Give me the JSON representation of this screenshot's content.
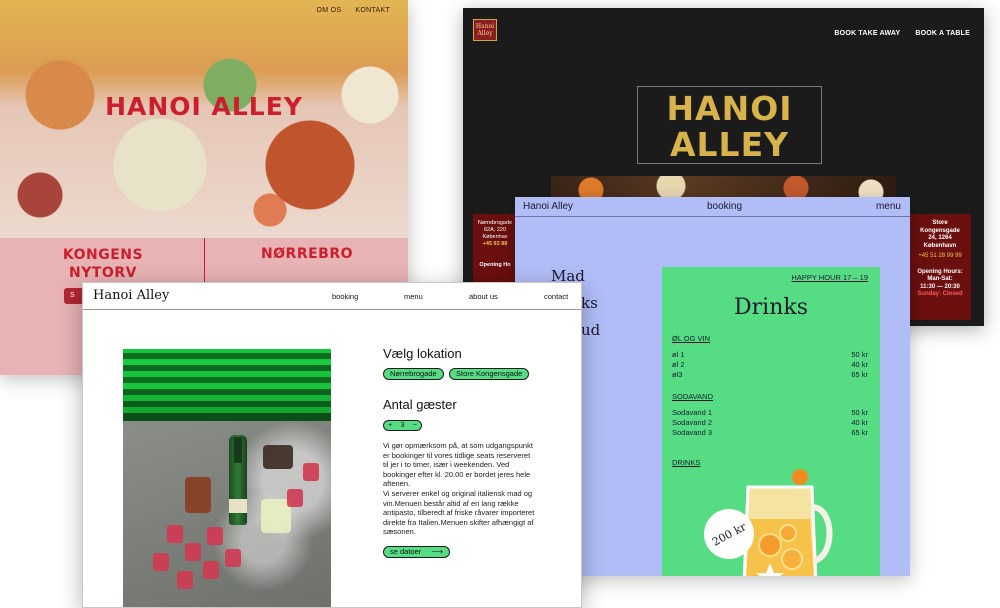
{
  "pink_site": {
    "nav": [
      "OM OS",
      "KONTAKT"
    ],
    "title": "HANOI ALLEY",
    "locations": [
      "KONGENS NYTORV",
      "NØRREBRO"
    ],
    "button_fragment": "S"
  },
  "dark_site": {
    "logo_text": [
      "Hanoi",
      "Alley"
    ],
    "nav": [
      "BOOK TAKE AWAY",
      "BOOK A TABLE"
    ],
    "title_line1": "HANOI",
    "title_line2": "ALLEY",
    "left_panel": {
      "address_line1": "Nørrebrogade",
      "address_line2": "62A, 220",
      "city": "Københav",
      "phone": "+45 93 88",
      "hours_heading": "Opening Ho"
    },
    "right_panel": {
      "store_label": "Store",
      "address_line1": "Kongensgade",
      "address_line2": "24, 1264",
      "city": "København",
      "phone": "+45 51 28 99 99",
      "hours_heading": "Opening Hours:",
      "days": "Man-Sat:",
      "hours": "11:30 — 20:30",
      "closed": "Sunday: Closed"
    }
  },
  "menu_site": {
    "brand": "Hanoi Alley",
    "nav_center": "booking",
    "nav_right": "menu",
    "side_links": [
      "Mad",
      "ks",
      "ud"
    ],
    "card": {
      "happy_hour": "HAPPY HOUR 17 – 19",
      "title": "Drinks",
      "sections": [
        {
          "heading": "ØL OG VIN",
          "items": [
            {
              "name": "øl 1",
              "price": "50 kr"
            },
            {
              "name": "øl 2",
              "price": "40 kr"
            },
            {
              "name": "øl3",
              "price": "65 kr"
            }
          ]
        },
        {
          "heading": "SODAVAND",
          "items": [
            {
              "name": "Sodavand 1",
              "price": "50 kr"
            },
            {
              "name": "Sodavand 2",
              "price": "40 kr"
            },
            {
              "name": "Sodavand 3",
              "price": "65 kr"
            }
          ]
        },
        {
          "heading": "DRINKS",
          "items": []
        }
      ],
      "badge": "200 kr"
    }
  },
  "booking_site": {
    "brand": "Hanoi Alley",
    "nav": [
      "booking",
      "menu",
      "about us",
      "contact"
    ],
    "location_heading": "Vælg lokation",
    "locations": [
      "Nørrebrogade",
      "Store Kongensgade"
    ],
    "guests_heading": "Antal gæster",
    "guests": {
      "minus": "+",
      "value": "3",
      "plus": "−"
    },
    "body_text": "Vi gør opmærksom på, at som udgangspunkt er bookinger til vores tidlige seats reserveret til jer i to timer, især i weekenden. Ved bookinger efter kl. 20.00 er bordet jeres hele aftenen.\nVi serverer enkel og original italiensk mad og vin.Menuen består altid af en lang række antipasto, tilberedt af friske råvarer importeret direkte fra Italien.Menuen skifter afhængigt af sæsonen.",
    "cta": "se datoer",
    "cta_arrow": "⟶"
  },
  "colors": {
    "pink_bg": "#e8b3b5",
    "brand_red": "#cc1e2d",
    "dark_bg": "#1b1b1b",
    "gold": "#d8b24a",
    "menu_blue": "#b1bdf7",
    "accent_green": "#56dd84"
  }
}
